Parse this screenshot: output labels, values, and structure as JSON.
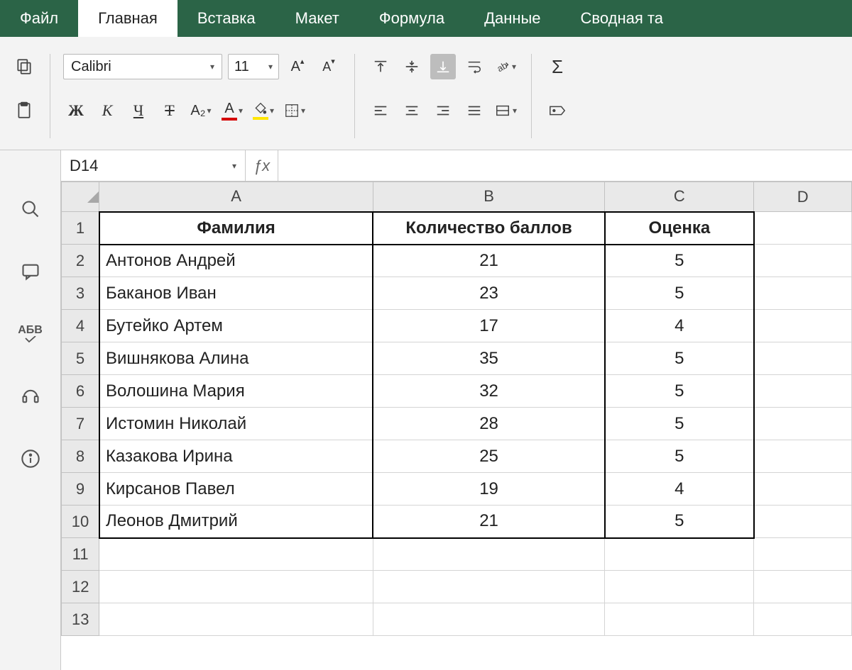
{
  "menu": {
    "items": [
      "Файл",
      "Главная",
      "Вставка",
      "Макет",
      "Формула",
      "Данные",
      "Сводная та"
    ],
    "active_index": 1
  },
  "ribbon": {
    "font_name": "Calibri",
    "font_size": "11",
    "bold_label": "Ж",
    "italic_label": "К",
    "underline_label": "Ч",
    "strike_label": "Т",
    "subscript_label": "A₂",
    "fontcolor_label": "A",
    "fillcolor_label": "",
    "font_color": "#d40000",
    "fill_color": "#ffe600"
  },
  "name_box": "D14",
  "fx_label": "ƒx",
  "formula_value": "",
  "columns": [
    "A",
    "B",
    "C",
    "D"
  ],
  "row_count": 13,
  "sheet": {
    "headers": [
      "Фамилия",
      "Количество баллов",
      "Оценка"
    ],
    "rows": [
      {
        "name": "Антонов Андрей",
        "points": "21",
        "grade": "5"
      },
      {
        "name": "Баканов Иван",
        "points": "23",
        "grade": "5"
      },
      {
        "name": "Бутейко Артем",
        "points": "17",
        "grade": "4"
      },
      {
        "name": "Вишнякова Алина",
        "points": "35",
        "grade": "5"
      },
      {
        "name": "Волошина Мария",
        "points": "32",
        "grade": "5"
      },
      {
        "name": "Истомин Николай",
        "points": "28",
        "grade": "5"
      },
      {
        "name": "Казакова Ирина",
        "points": "25",
        "grade": "5"
      },
      {
        "name": "Кирсанов Павел",
        "points": "19",
        "grade": "4"
      },
      {
        "name": "Леонов Дмитрий",
        "points": "21",
        "grade": "5"
      }
    ]
  }
}
